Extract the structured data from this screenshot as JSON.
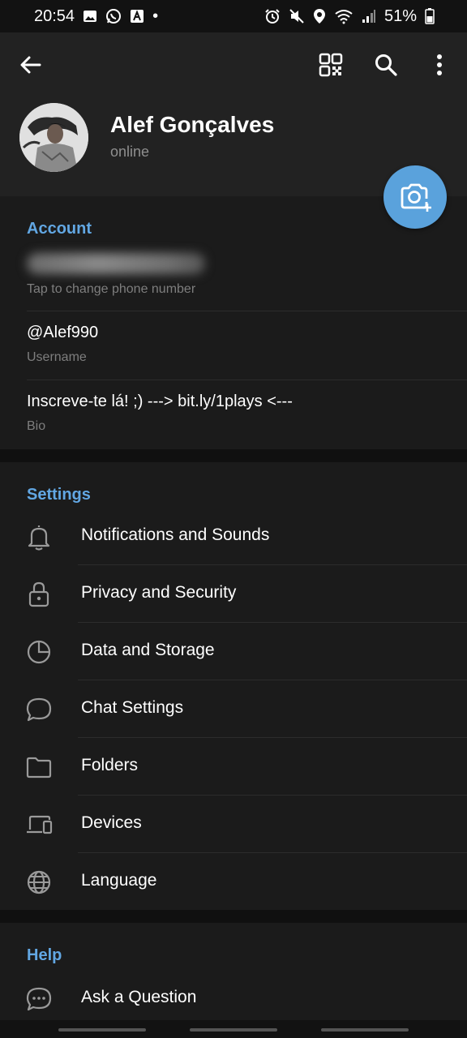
{
  "status_bar": {
    "time": "20:54",
    "dot": "•",
    "battery_text": "51%"
  },
  "header": {
    "name": "Alef Gonçalves",
    "status": "online"
  },
  "account": {
    "title": "Account",
    "phone_label": "Tap to change phone number",
    "username_value": "@Alef990",
    "username_label": "Username",
    "bio_value": "Inscreve-te lá! ;) ---> bit.ly/1plays <---",
    "bio_label": "Bio"
  },
  "settings": {
    "title": "Settings",
    "items": [
      {
        "label": "Notifications and Sounds",
        "icon": "bell-icon"
      },
      {
        "label": "Privacy and Security",
        "icon": "lock-icon"
      },
      {
        "label": "Data and Storage",
        "icon": "pie-chart-icon"
      },
      {
        "label": "Chat Settings",
        "icon": "chat-bubble-icon"
      },
      {
        "label": "Folders",
        "icon": "folder-icon"
      },
      {
        "label": "Devices",
        "icon": "devices-icon"
      },
      {
        "label": "Language",
        "icon": "globe-icon"
      }
    ]
  },
  "help": {
    "title": "Help",
    "items": [
      {
        "label": "Ask a Question",
        "icon": "question-chat-icon"
      }
    ]
  },
  "colors": {
    "accent": "#62a7e3",
    "fab": "#5aa2dc",
    "background": "#1b1b1b",
    "header": "#222222"
  }
}
